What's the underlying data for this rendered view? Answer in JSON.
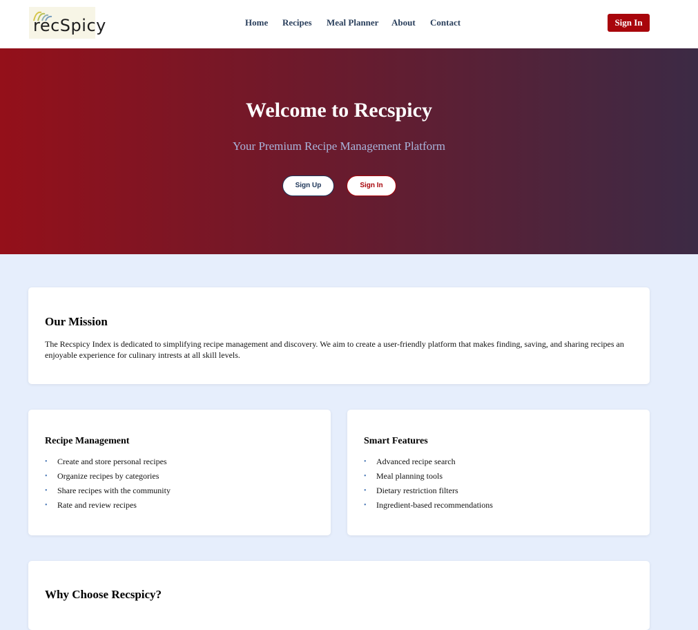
{
  "header": {
    "logo_text": "recSpicy",
    "nav": [
      "Home",
      "Recipes",
      "Meal Planner",
      "About",
      "Contact"
    ],
    "sign_in": "Sign In"
  },
  "hero": {
    "title": "Welcome to Recspicy",
    "subtitle": "Your Premium Recipe Management Platform",
    "signup_label": "Sign Up",
    "signin_label": "Sign In"
  },
  "mission": {
    "title": "Our Mission",
    "text": "The Recspicy Index is dedicated to simplifying recipe management and discovery. We aim to create a user-friendly platform that makes finding, saving, and sharing recipes an enjoyable experience for culinary intrests at all skill levels."
  },
  "features": [
    {
      "title": "Recipe Management",
      "items": [
        "Create and store personal recipes",
        "Organize recipes by categories",
        "Share recipes with the community",
        "Rate and review recipes"
      ]
    },
    {
      "title": "Smart Features",
      "items": [
        "Advanced recipe search",
        "Meal planning tools",
        "Dietary restriction filters",
        "Ingredient-based recommendations"
      ]
    }
  ],
  "why": {
    "title": "Why Choose Recspicy?"
  },
  "colors": {
    "brand_red": "#a8050b",
    "nav_text": "#2a3f5c",
    "page_bg": "#e6eefc",
    "bullet": "#4a78b5"
  },
  "icons": {
    "bullet": "bullet-dot"
  }
}
